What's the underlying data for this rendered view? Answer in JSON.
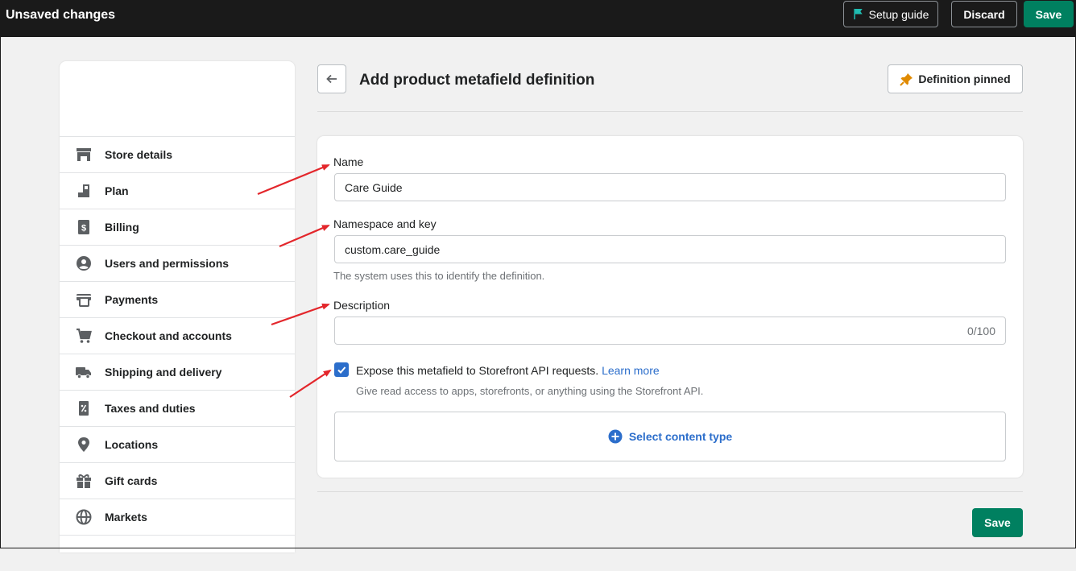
{
  "topbar": {
    "title": "Unsaved changes",
    "setup_label": "Setup guide",
    "discard_label": "Discard",
    "save_label": "Save"
  },
  "sidebar": {
    "items": [
      {
        "label": "Store details",
        "icon": "store-icon"
      },
      {
        "label": "Plan",
        "icon": "plan-icon"
      },
      {
        "label": "Billing",
        "icon": "billing-icon"
      },
      {
        "label": "Users and permissions",
        "icon": "user-icon"
      },
      {
        "label": "Payments",
        "icon": "payments-icon"
      },
      {
        "label": "Checkout and accounts",
        "icon": "cart-icon"
      },
      {
        "label": "Shipping and delivery",
        "icon": "truck-icon"
      },
      {
        "label": "Taxes and duties",
        "icon": "tax-icon"
      },
      {
        "label": "Locations",
        "icon": "location-icon"
      },
      {
        "label": "Gift cards",
        "icon": "gift-icon"
      },
      {
        "label": "Markets",
        "icon": "globe-icon"
      }
    ]
  },
  "page": {
    "title": "Add product metafield definition",
    "pinned_label": "Definition pinned"
  },
  "form": {
    "name_label": "Name",
    "name_value": "Care Guide",
    "namespace_label": "Namespace and key",
    "namespace_value": "custom.care_guide",
    "namespace_help": "The system uses this to identify the definition.",
    "description_label": "Description",
    "description_value": "",
    "description_counter": "0/100",
    "expose_label": "Expose this metafield to Storefront API requests.",
    "expose_link": "Learn more",
    "expose_help": "Give read access to apps, storefronts, or anything using the Storefront API.",
    "content_type_label": "Select content type"
  },
  "footer": {
    "save_label": "Save"
  },
  "colors": {
    "primary_green": "#008060",
    "link_blue": "#2c6ecb",
    "annotation_red": "#e3262b",
    "topbar_bg": "#1a1a1a"
  }
}
